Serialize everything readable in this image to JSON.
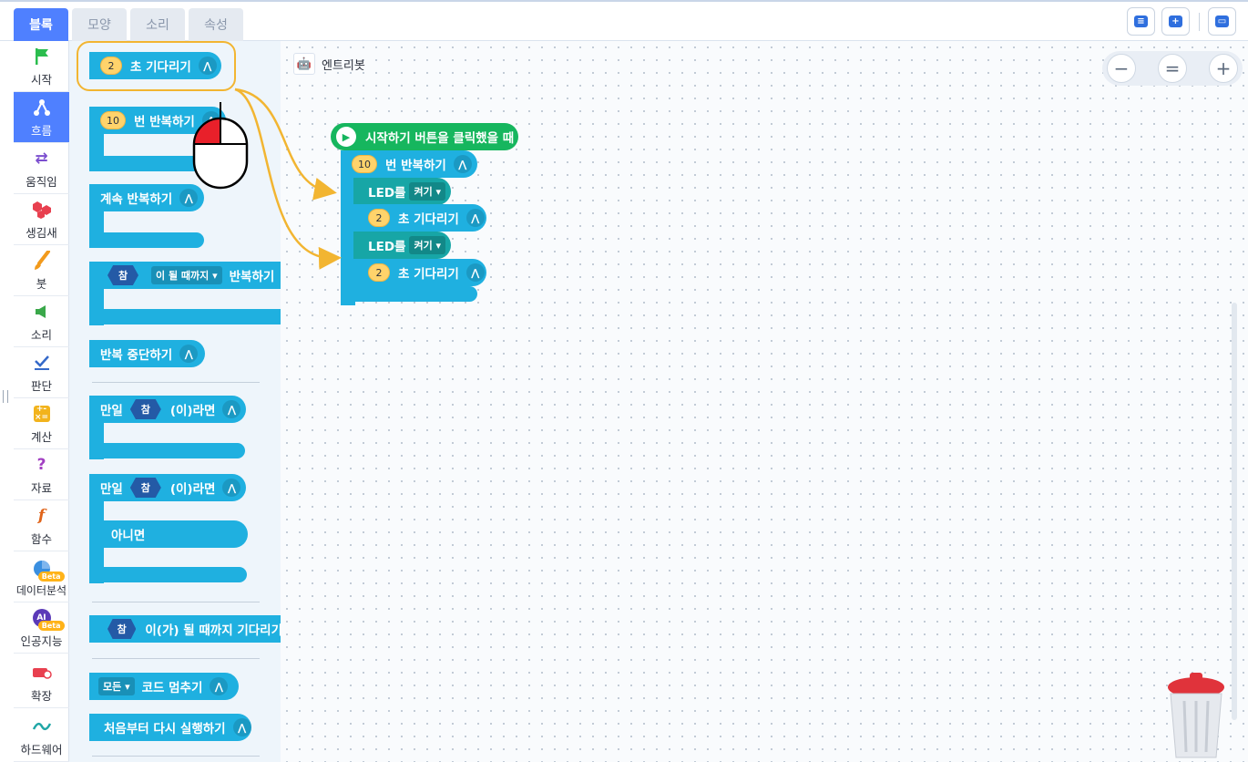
{
  "tabs": [
    {
      "label": "블록",
      "active": true
    },
    {
      "label": "모양",
      "active": false
    },
    {
      "label": "소리",
      "active": false
    },
    {
      "label": "속성",
      "active": false
    }
  ],
  "categories": [
    {
      "label": "시작",
      "icon": "flag-icon",
      "color": "#2bbd4e"
    },
    {
      "label": "흐름",
      "icon": "flow-icon",
      "color": "#ffffff",
      "active": true
    },
    {
      "label": "움직임",
      "icon": "arrows-icon",
      "color": "#7b4ecf"
    },
    {
      "label": "생김새",
      "icon": "shapes-icon",
      "color": "#e8404f"
    },
    {
      "label": "붓",
      "icon": "brush-icon",
      "color": "#f29a1c"
    },
    {
      "label": "소리",
      "icon": "speaker-icon",
      "color": "#3aa84a"
    },
    {
      "label": "판단",
      "icon": "check-icon",
      "color": "#3569c9"
    },
    {
      "label": "계산",
      "icon": "calc-icon",
      "color": "#f2b31c"
    },
    {
      "label": "자료",
      "icon": "question-icon",
      "color": "#a23fc2"
    },
    {
      "label": "함수",
      "icon": "function-icon",
      "color": "#e0641a"
    },
    {
      "label": "데이터분석",
      "icon": "pie-icon",
      "color": "#3a8fe0",
      "badge": "Beta"
    },
    {
      "label": "인공지능",
      "icon": "ai-icon",
      "color": "#5b3ab8",
      "badge": "Beta"
    },
    {
      "label": "확장",
      "icon": "extension-icon",
      "color": "#e8404f"
    },
    {
      "label": "하드웨어",
      "icon": "hardware-icon",
      "color": "#1fa6a6"
    }
  ],
  "palette": {
    "wait": {
      "num": "2",
      "label": "초 기다리기"
    },
    "repeat_n": {
      "num": "10",
      "label": "번 반복하기"
    },
    "repeat_forever": {
      "label": "계속 반복하기"
    },
    "repeat_until": {
      "hex": "참",
      "dropdown": "이 될 때까지 ▾",
      "label": "반복하기"
    },
    "break_loop": {
      "label": "반복 중단하기"
    },
    "if": {
      "prefix": "만일",
      "hex": "참",
      "suffix": "(이)라면"
    },
    "if_else": {
      "prefix": "만일",
      "hex": "참",
      "suffix": "(이)라면",
      "else": "아니면"
    },
    "wait_until": {
      "hex": "참",
      "label": "이(가) 될 때까지 기다리기"
    },
    "stop_code": {
      "dropdown": "모든 ▾",
      "label": "코드 멈추기"
    },
    "restart": {
      "label": "처음부터 다시 실행하기"
    }
  },
  "canvas": {
    "sprite_name": "엔트리봇",
    "zoom": {
      "minus": "−",
      "reset": "=",
      "plus": "+"
    },
    "script": {
      "hat": "시작하기 버튼을 클릭했을 때",
      "repeat": {
        "num": "10",
        "label": "번 반복하기"
      },
      "led1": {
        "label": "LED를",
        "dropdown": "켜기 ▾"
      },
      "wait1": {
        "num": "2",
        "label": "초 기다리기"
      },
      "led2": {
        "label": "LED를",
        "dropdown": "켜기 ▾"
      },
      "wait2": {
        "num": "2",
        "label": "초 기다리기"
      }
    }
  }
}
